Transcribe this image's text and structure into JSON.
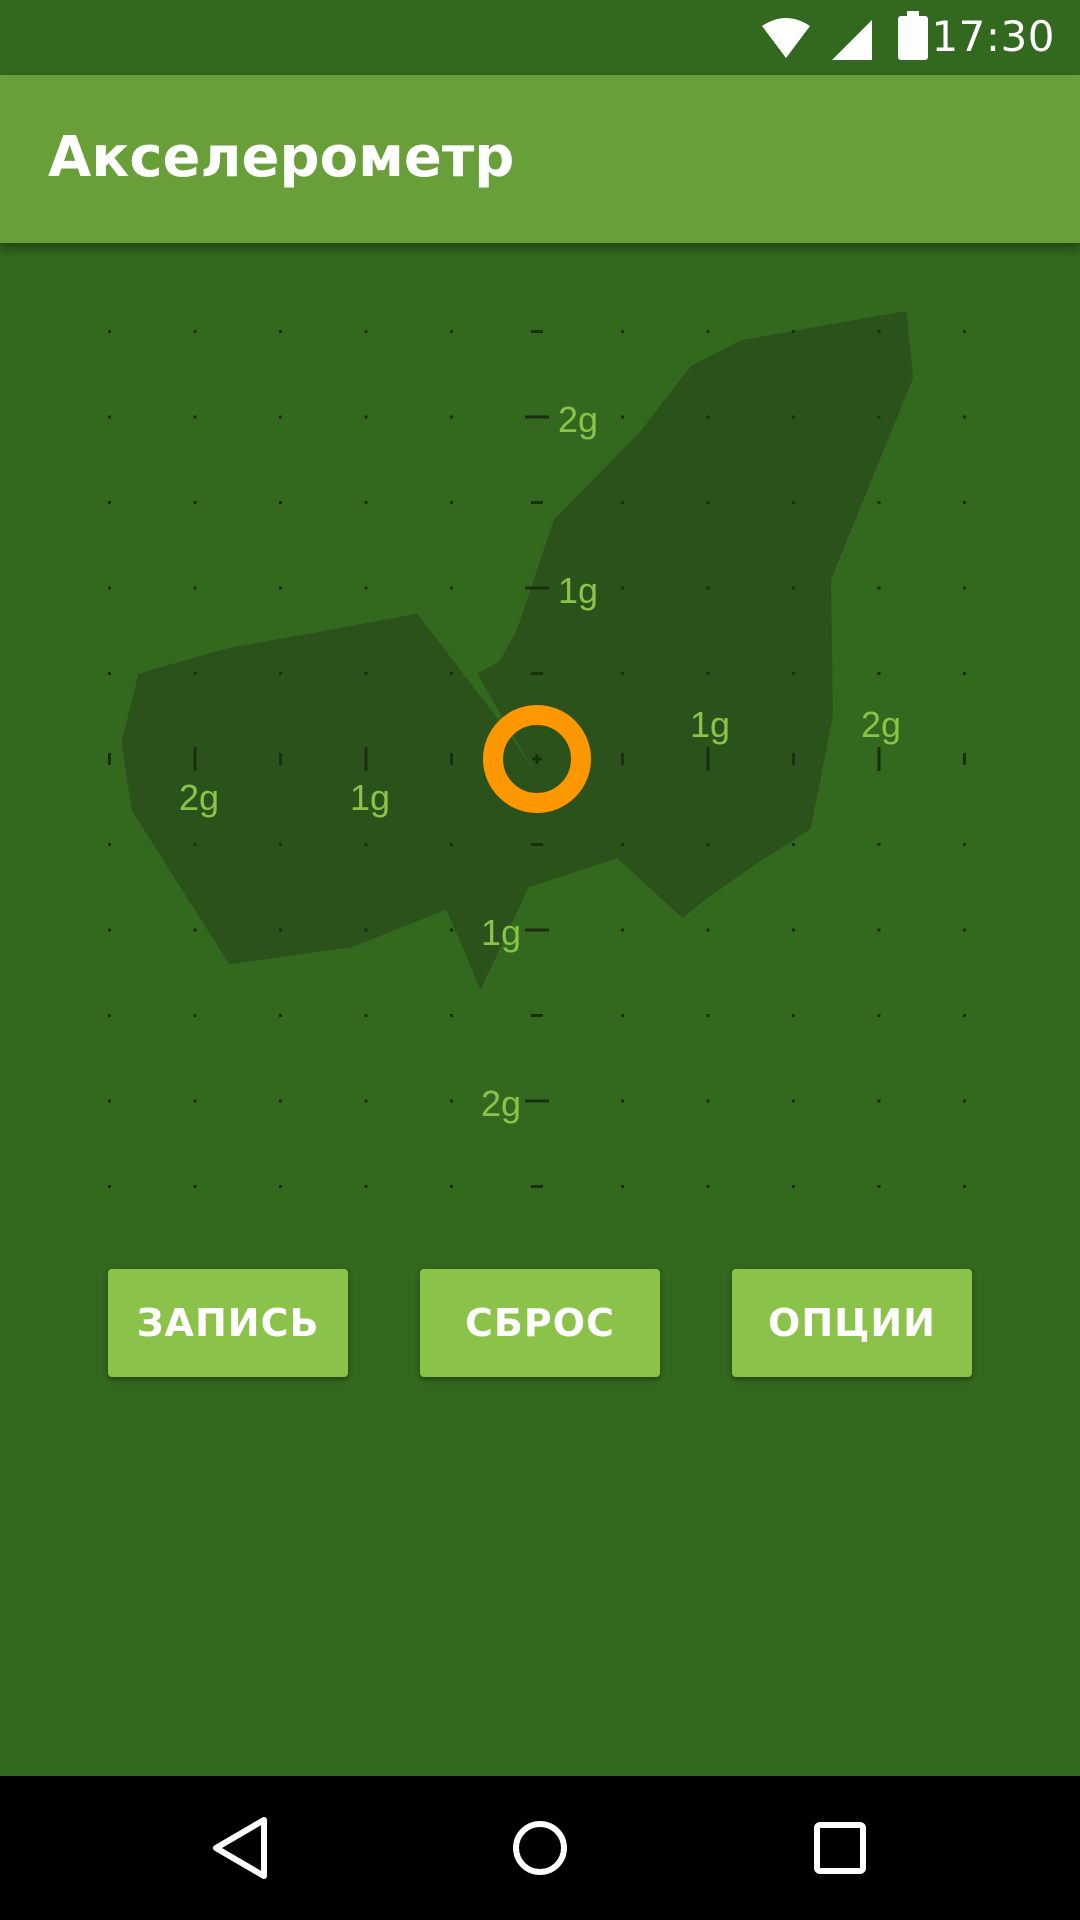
{
  "status_bar": {
    "time": "17:30",
    "icons": [
      "wifi-icon",
      "cell-signal-icon",
      "battery-icon"
    ]
  },
  "app_bar": {
    "title": "Акселерометр"
  },
  "plot": {
    "axis_labels": {
      "x_pos_1": "1g",
      "x_pos_2": "2g",
      "x_neg_1": "1g",
      "x_neg_2": "2g",
      "y_pos_1": "1g",
      "y_pos_2": "2g",
      "y_neg_1": "1g",
      "y_neg_2": "2g"
    },
    "colors": {
      "background": "#33691e",
      "trace_area": "#2a521a",
      "label": "#8bc34a",
      "tick": "#1b2e10",
      "indicator": "#ff9800"
    },
    "indicator": "orange-ring",
    "trace_outline_g": [
      [
        0.0,
        -0.1
      ],
      [
        -0.15,
        0.13
      ],
      [
        -0.7,
        0.85
      ],
      [
        -1.35,
        0.73
      ],
      [
        -1.8,
        0.65
      ],
      [
        -2.33,
        0.5
      ],
      [
        -2.43,
        0.1
      ],
      [
        -2.37,
        -0.3
      ],
      [
        -1.8,
        -1.2
      ],
      [
        -1.08,
        -1.1
      ],
      [
        -0.53,
        -0.88
      ],
      [
        -0.33,
        -1.35
      ],
      [
        -0.05,
        -0.75
      ],
      [
        0.47,
        -0.58
      ],
      [
        0.85,
        -0.93
      ],
      [
        1.0,
        -0.81
      ],
      [
        1.3,
        -0.6
      ],
      [
        1.6,
        -0.41
      ],
      [
        1.73,
        0.25
      ],
      [
        1.72,
        1.05
      ],
      [
        2.2,
        2.23
      ],
      [
        2.16,
        2.62
      ],
      [
        1.2,
        2.45
      ],
      [
        0.9,
        2.3
      ],
      [
        0.6,
        1.91
      ],
      [
        0.1,
        1.4
      ],
      [
        -0.12,
        0.75
      ],
      [
        -0.22,
        0.57
      ],
      [
        -0.35,
        0.5
      ]
    ]
  },
  "buttons": {
    "record": "ЗАПИСЬ",
    "reset": "СБРОС",
    "options": "ОПЦИИ"
  }
}
